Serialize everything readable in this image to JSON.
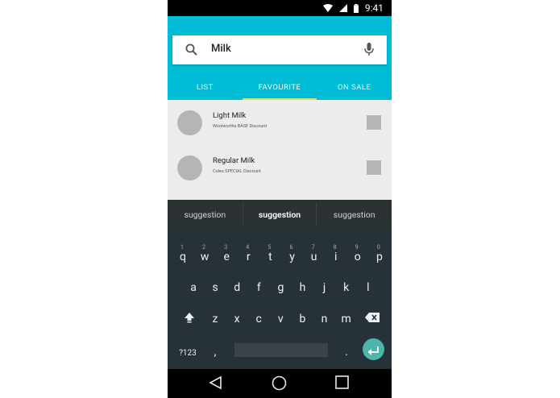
{
  "status_bar": {
    "time": "9:41",
    "icons": [
      "wifi-icon",
      "signal-icon",
      "battery-icon"
    ]
  },
  "search": {
    "query": "Milk",
    "icons": [
      "search-icon",
      "mic-icon"
    ]
  },
  "tabs": [
    {
      "label": "LIST",
      "active": false
    },
    {
      "label": "FAVOURITE",
      "active": true
    },
    {
      "label": "ON SALE",
      "active": false
    }
  ],
  "items": [
    {
      "title": "Light Milk",
      "subtitle": "Woolworths BASE Discount"
    },
    {
      "title": "Regular Milk",
      "subtitle": "Coles SPECIAL Discount"
    }
  ],
  "suggestions": [
    "suggestion",
    "suggestion",
    "suggestion"
  ],
  "keyboard": {
    "row1": [
      "q",
      "w",
      "e",
      "r",
      "t",
      "y",
      "u",
      "i",
      "o",
      "p"
    ],
    "row1_hints": [
      "1",
      "2",
      "3",
      "4",
      "5",
      "6",
      "7",
      "8",
      "9",
      "0"
    ],
    "row2": [
      "a",
      "s",
      "d",
      "f",
      "g",
      "h",
      "j",
      "k",
      "l"
    ],
    "row3": [
      "z",
      "x",
      "c",
      "v",
      "b",
      "n",
      "m"
    ],
    "symbols_label": "?123",
    "comma": ",",
    "period": ".",
    "icons": [
      "shift-icon",
      "backspace-icon",
      "enter-icon"
    ]
  },
  "nav_icons": [
    "back-icon",
    "home-icon",
    "recents-icon"
  ],
  "colors": {
    "app_bar": "#00bcd4",
    "tab_indicator": "#c5e86c",
    "keyboard_bg": "#263238",
    "enter_key": "#4db6ac"
  }
}
